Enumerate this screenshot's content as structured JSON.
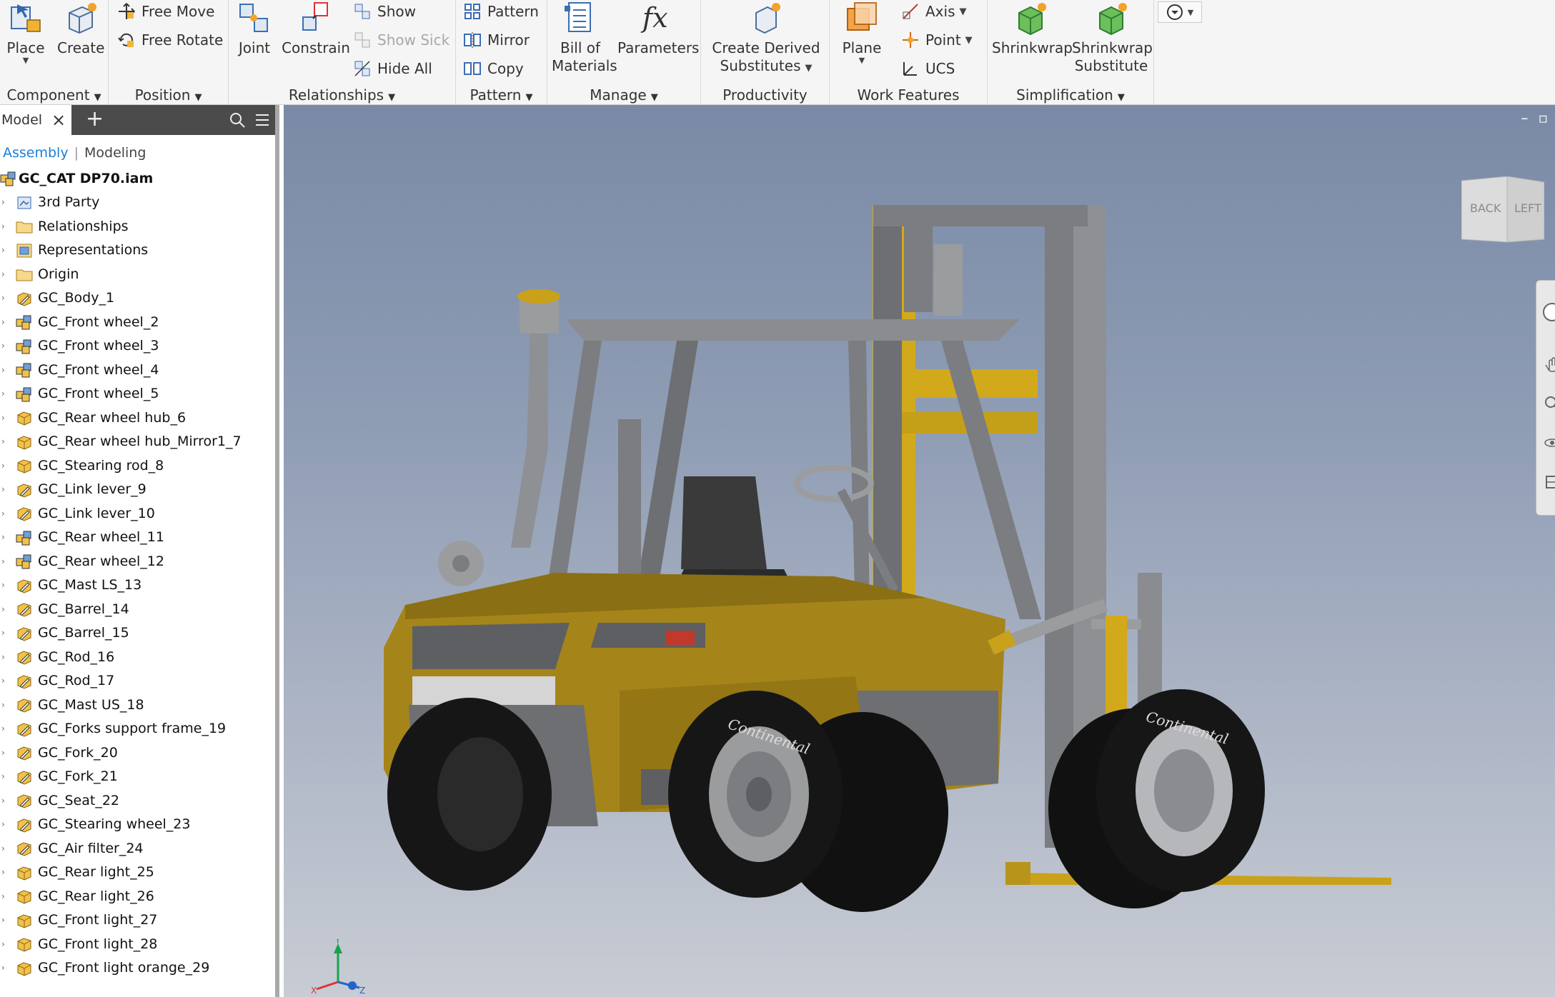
{
  "ribbon": {
    "component": {
      "label": "Component",
      "place": "Place",
      "create": "Create"
    },
    "position": {
      "label": "Position",
      "free_move": "Free Move",
      "free_rotate": "Free Rotate"
    },
    "relationships": {
      "label": "Relationships",
      "joint": "Joint",
      "constrain": "Constrain",
      "show": "Show",
      "show_sick": "Show Sick",
      "hide_all": "Hide All"
    },
    "pattern": {
      "label": "Pattern",
      "pattern": "Pattern",
      "mirror": "Mirror",
      "copy": "Copy"
    },
    "manage": {
      "label": "Manage",
      "bom_line1": "Bill of",
      "bom_line2": "Materials",
      "parameters": "Parameters"
    },
    "productivity": {
      "label": "Productivity",
      "derived_line1": "Create Derived",
      "derived_line2": "Substitutes"
    },
    "work_features": {
      "label": "Work Features",
      "plane": "Plane",
      "axis": "Axis",
      "point": "Point",
      "ucs": "UCS"
    },
    "simplification": {
      "label": "Simplification",
      "shrinkwrap": "Shrinkwrap",
      "shrink_sub_line1": "Shrinkwrap",
      "shrink_sub_line2": "Substitute"
    }
  },
  "panel": {
    "tab": "Model",
    "subtab_assembly": "Assembly",
    "subtab_modeling": "Modeling",
    "root": "GC_CAT DP70.iam",
    "items": [
      {
        "label": "3rd Party",
        "icon": "third-party"
      },
      {
        "label": "Relationships",
        "icon": "folder"
      },
      {
        "label": "Representations",
        "icon": "representations"
      },
      {
        "label": "Origin",
        "icon": "folder"
      },
      {
        "label": "GC_Body_1",
        "icon": "part-edit"
      },
      {
        "label": "GC_Front wheel_2",
        "icon": "subassembly"
      },
      {
        "label": "GC_Front wheel_3",
        "icon": "subassembly"
      },
      {
        "label": "GC_Front wheel_4",
        "icon": "subassembly"
      },
      {
        "label": "GC_Front wheel_5",
        "icon": "subassembly"
      },
      {
        "label": "GC_Rear wheel hub_6",
        "icon": "part"
      },
      {
        "label": "GC_Rear wheel hub_Mirror1_7",
        "icon": "part"
      },
      {
        "label": "GC_Stearing rod_8",
        "icon": "part"
      },
      {
        "label": "GC_Link lever_9",
        "icon": "part-edit"
      },
      {
        "label": "GC_Link lever_10",
        "icon": "part-edit"
      },
      {
        "label": "GC_Rear wheel_11",
        "icon": "subassembly"
      },
      {
        "label": "GC_Rear wheel_12",
        "icon": "subassembly"
      },
      {
        "label": "GC_Mast LS_13",
        "icon": "part-edit"
      },
      {
        "label": "GC_Barrel_14",
        "icon": "part-edit"
      },
      {
        "label": "GC_Barrel_15",
        "icon": "part-edit"
      },
      {
        "label": "GC_Rod_16",
        "icon": "part-edit"
      },
      {
        "label": "GC_Rod_17",
        "icon": "part-edit"
      },
      {
        "label": "GC_Mast US_18",
        "icon": "part-edit"
      },
      {
        "label": "GC_Forks support frame_19",
        "icon": "part-edit"
      },
      {
        "label": "GC_Fork_20",
        "icon": "part-edit"
      },
      {
        "label": "GC_Fork_21",
        "icon": "part-edit"
      },
      {
        "label": "GC_Seat_22",
        "icon": "part-edit"
      },
      {
        "label": "GC_Stearing wheel_23",
        "icon": "part-edit"
      },
      {
        "label": "GC_Air filter_24",
        "icon": "part-edit"
      },
      {
        "label": "GC_Rear light_25",
        "icon": "part"
      },
      {
        "label": "GC_Rear light_26",
        "icon": "part"
      },
      {
        "label": "GC_Front light_27",
        "icon": "part"
      },
      {
        "label": "GC_Front light_28",
        "icon": "part"
      },
      {
        "label": "GC_Front light orange_29",
        "icon": "part"
      }
    ]
  },
  "viewport": {
    "viewcube_back": "BACK",
    "viewcube_left": "LEFT",
    "tire_brand": "Continental",
    "triad_x": "X",
    "triad_y": "Y",
    "triad_z": "Z"
  },
  "colors": {
    "body": "#a5841a",
    "mast": "#d2a91a",
    "frame": "#7b7d80",
    "tire": "#161616",
    "accent": "#1a7ed6"
  }
}
